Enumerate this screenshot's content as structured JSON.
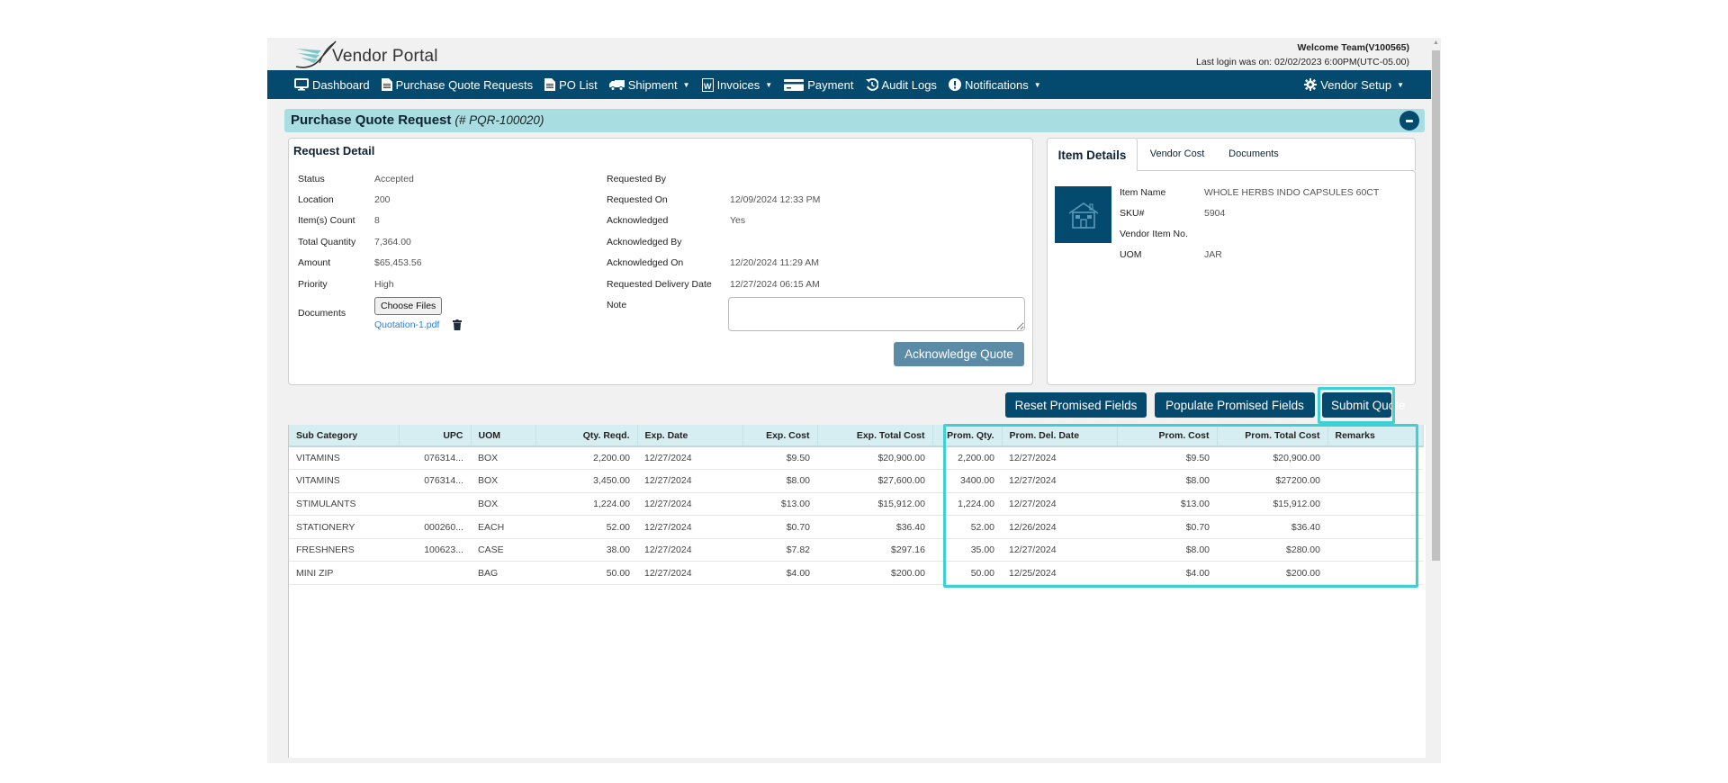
{
  "header": {
    "brand": "Vendor Portal",
    "welcome": "Welcome Team(V100565)",
    "last_login": "Last login was on: 02/02/2023 6:00PM(UTC-05.00)"
  },
  "nav": {
    "items": [
      {
        "label": "Dashboard",
        "icon": "monitor-icon"
      },
      {
        "label": "Purchase Quote Requests",
        "icon": "document-icon"
      },
      {
        "label": "PO List",
        "icon": "document-icon"
      },
      {
        "label": "Shipment",
        "icon": "truck-icon",
        "dropdown": true
      },
      {
        "label": "Invoices",
        "icon": "word-document-icon",
        "dropdown": true
      },
      {
        "label": "Payment",
        "icon": "credit-card-icon"
      },
      {
        "label": "Audit Logs",
        "icon": "history-icon"
      },
      {
        "label": "Notifications",
        "icon": "exclamation-circle-icon",
        "dropdown": true
      }
    ],
    "vendor_setup": "Vendor Setup"
  },
  "page": {
    "title": "Purchase Quote Request",
    "id": "(# PQR-100020)"
  },
  "request_detail": {
    "heading": "Request Detail",
    "left": [
      {
        "label": "Status",
        "value": "Accepted"
      },
      {
        "label": "Location",
        "value": "200"
      },
      {
        "label": "Item(s) Count",
        "value": "8"
      },
      {
        "label": "Total Quantity",
        "value": "7,364.00"
      },
      {
        "label": "Amount",
        "value": "$65,453.56"
      },
      {
        "label": "Priority",
        "value": "High"
      }
    ],
    "documents_label": "Documents",
    "choose_files": "Choose Files",
    "file_name": "Quotation-1.pdf",
    "right": [
      {
        "label": "Requested By",
        "value": ""
      },
      {
        "label": "Requested On",
        "value": "12/09/2024 12:33 PM"
      },
      {
        "label": "Acknowledged",
        "value": "Yes"
      },
      {
        "label": "Acknowledged By",
        "value": ""
      },
      {
        "label": "Acknowledged On",
        "value": "12/20/2024 11:29 AM"
      },
      {
        "label": "Requested Delivery Date",
        "value": "12/27/2024 06:15 AM"
      }
    ],
    "note_label": "Note",
    "note_value": "",
    "acknowledge_button": "Acknowledge Quote"
  },
  "item_panel": {
    "tabs": [
      "Item Details",
      "Vendor Cost",
      "Documents"
    ],
    "active_tab": "Item Details",
    "fields": [
      {
        "label": "Item Name",
        "value": "WHOLE HERBS INDO CAPSULES 60CT"
      },
      {
        "label": "SKU#",
        "value": "5904"
      },
      {
        "label": "Vendor Item No.",
        "value": ""
      },
      {
        "label": "UOM",
        "value": "JAR"
      }
    ]
  },
  "actions": {
    "reset": "Reset Promised Fields",
    "populate": "Populate Promised Fields",
    "submit": "Submit Quote"
  },
  "grid": {
    "columns": [
      "Sub Category",
      "UPC",
      "UOM",
      "Qty. Reqd.",
      "Exp. Date",
      "Exp. Cost",
      "Exp. Total Cost",
      "Prom. Qty.",
      "Prom. Del. Date",
      "Prom. Cost",
      "Prom. Total Cost",
      "Remarks"
    ],
    "rows": [
      [
        "VITAMINS",
        "076314...",
        "BOX",
        "2,200.00",
        "12/27/2024",
        "$9.50",
        "$20,900.00",
        "2,200.00",
        "12/27/2024",
        "$9.50",
        "$20,900.00",
        ""
      ],
      [
        "VITAMINS",
        "076314...",
        "BOX",
        "3,450.00",
        "12/27/2024",
        "$8.00",
        "$27,600.00",
        "3400.00",
        "12/27/2024",
        "$8.00",
        "$27200.00",
        ""
      ],
      [
        "STIMULANTS",
        "",
        "BOX",
        "1,224.00",
        "12/27/2024",
        "$13.00",
        "$15,912.00",
        "1,224.00",
        "12/27/2024",
        "$13.00",
        "$15,912.00",
        ""
      ],
      [
        "STATIONERY",
        "000260...",
        "EACH",
        "52.00",
        "12/27/2024",
        "$0.70",
        "$36.40",
        "52.00",
        "12/26/2024",
        "$0.70",
        "$36.40",
        ""
      ],
      [
        "FRESHNERS",
        "100623...",
        "CASE",
        "38.00",
        "12/27/2024",
        "$7.82",
        "$297.16",
        "35.00",
        "12/27/2024",
        "$8.00",
        "$280.00",
        ""
      ],
      [
        "MINI ZIP",
        "",
        "BAG",
        "50.00",
        "12/27/2024",
        "$4.00",
        "$200.00",
        "50.00",
        "12/25/2024",
        "$4.00",
        "$200.00",
        ""
      ]
    ]
  },
  "colors": {
    "nav_bg": "#034a6e",
    "header_band": "#a8dde2",
    "highlight": "#3fd0d4",
    "grid_header": "#d6eef2"
  }
}
